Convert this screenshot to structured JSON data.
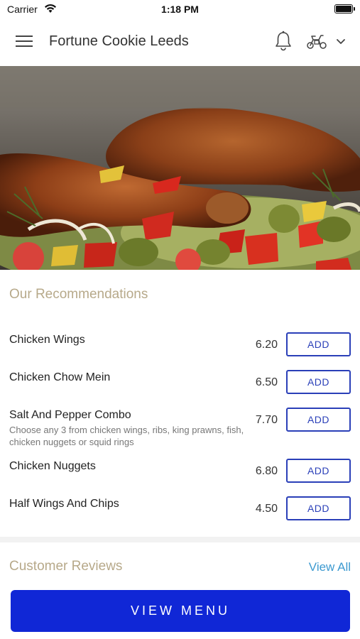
{
  "status_bar": {
    "carrier": "Carrier",
    "time": "1:18 PM"
  },
  "header": {
    "title": "Fortune Cookie Leeds",
    "icons": [
      "menu-icon",
      "bell-icon",
      "scooter-icon",
      "chevron-down-icon"
    ]
  },
  "hero": {
    "image": "roast-chicken-legs-with-vegetables"
  },
  "recommendations": {
    "title": "Our Recommendations",
    "add_label": "ADD",
    "items": [
      {
        "name": "Chicken Wings",
        "price": "6.20",
        "description": ""
      },
      {
        "name": "Chicken Chow Mein",
        "price": "6.50",
        "description": ""
      },
      {
        "name": "Salt And Pepper Combo",
        "price": "7.70",
        "description": "Choose any 3 from chicken wings, ribs, king prawns, fish, chicken nuggets or squid rings"
      },
      {
        "name": "Chicken Nuggets",
        "price": "6.80",
        "description": ""
      },
      {
        "name": "Half Wings And Chips",
        "price": "4.50",
        "description": ""
      }
    ]
  },
  "reviews": {
    "title": "Customer Reviews",
    "view_all_label": "View All"
  },
  "footer": {
    "view_menu_label": "VIEW MENU"
  },
  "colors": {
    "accent_blue": "#1027d6",
    "add_button_blue": "#2a3fb8",
    "section_title_gold": "#b7a98a",
    "link_blue": "#3d9ad0"
  }
}
